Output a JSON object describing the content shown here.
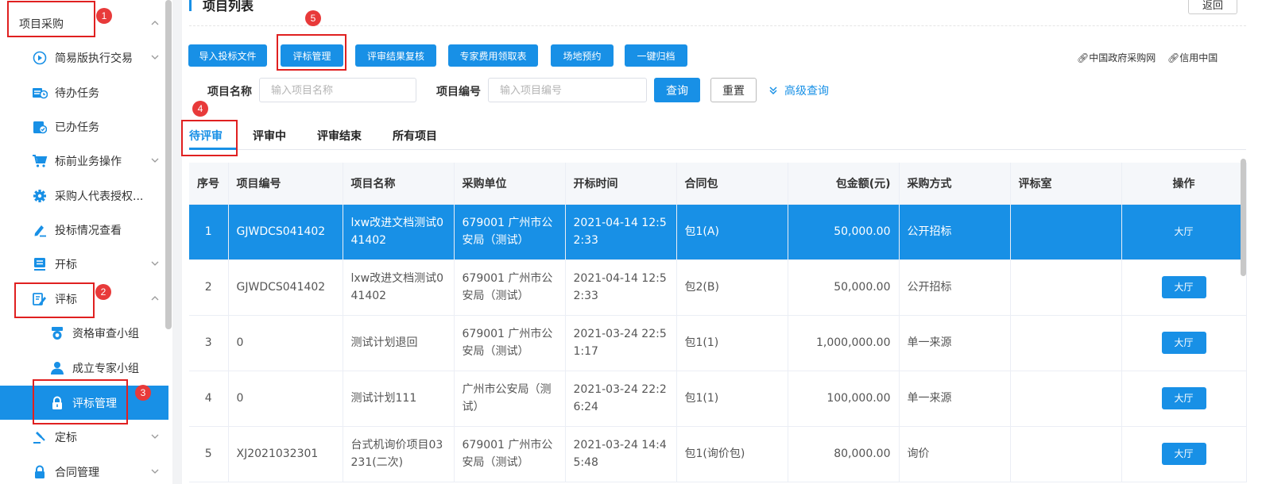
{
  "sidebar": {
    "items": [
      {
        "label": "项目采购",
        "icon": "none"
      },
      {
        "label": "简易版执行交易",
        "icon": "play-circle-icon"
      },
      {
        "label": "待办任务",
        "icon": "todo-icon"
      },
      {
        "label": "已办任务",
        "icon": "done-task-icon"
      },
      {
        "label": "标前业务操作",
        "icon": "cart-icon"
      },
      {
        "label": "采购人代表授权...",
        "icon": "gear-icon"
      },
      {
        "label": "投标情况查看",
        "icon": "edit-icon"
      },
      {
        "label": "开标",
        "icon": "document-icon"
      },
      {
        "label": "评标",
        "icon": "evaluate-icon"
      },
      {
        "label": "资格审查小组",
        "icon": "medal-icon"
      },
      {
        "label": "成立专家小组",
        "icon": "user-icon"
      },
      {
        "label": "评标管理",
        "icon": "lock-icon"
      },
      {
        "label": "定标",
        "icon": "gavel-icon"
      },
      {
        "label": "合同管理",
        "icon": "lock-icon"
      }
    ]
  },
  "annotations": [
    "1",
    "2",
    "3",
    "4",
    "5"
  ],
  "header": {
    "title": "项目列表",
    "back": "返回"
  },
  "toolbar": {
    "buttons": [
      "导入投标文件",
      "评标管理",
      "评审结果复核",
      "专家费用领取表",
      "场地预约",
      "一键归档"
    ],
    "links": [
      "中国政府采购网",
      "信用中国"
    ]
  },
  "search": {
    "name_label": "项目名称",
    "name_placeholder": "输入项目名称",
    "code_label": "项目编号",
    "code_placeholder": "输入项目编号",
    "query": "查询",
    "reset": "重置",
    "advanced": "高级查询"
  },
  "tabs": [
    "待评审",
    "评审中",
    "评审结束",
    "所有项目"
  ],
  "table": {
    "headers": [
      "序号",
      "项目编号",
      "项目名称",
      "采购单位",
      "开标时间",
      "合同包",
      "包金额(元)",
      "采购方式",
      "评标室",
      "操作"
    ],
    "rows": [
      [
        "1",
        "GJWDCS041402",
        "lxw改进文档测试041402",
        "679001 广州市公安局（测试）",
        "2021-04-14 12:52:33",
        "包1(A)",
        "50,000.00",
        "公开招标",
        "",
        "大厅"
      ],
      [
        "2",
        "GJWDCS041402",
        "lxw改进文档测试041402",
        "679001 广州市公安局（测试）",
        "2021-04-14 12:52:33",
        "包2(B)",
        "50,000.00",
        "公开招标",
        "",
        "大厅"
      ],
      [
        "3",
        "0",
        "测试计划退回",
        "679001 广州市公安局（测试）",
        "2021-03-24 22:51:17",
        "包1(1)",
        "1,000,000.00",
        "单一来源",
        "",
        "大厅"
      ],
      [
        "4",
        "0",
        "测试计划111",
        "广州市公安局（测试）",
        "2021-03-24 22:26:24",
        "包1(1)",
        "100,000.00",
        "单一来源",
        "",
        "大厅"
      ],
      [
        "5",
        "XJ2021032301",
        "台式机询价项目03231(二次)",
        "679001 广州市公安局（测试）",
        "2021-03-24 14:45:48",
        "包1(询价包)",
        "80,000.00",
        "询价",
        "",
        "大厅"
      ]
    ]
  },
  "colors": {
    "primary": "#1890e6",
    "annotation": "#e02020"
  }
}
